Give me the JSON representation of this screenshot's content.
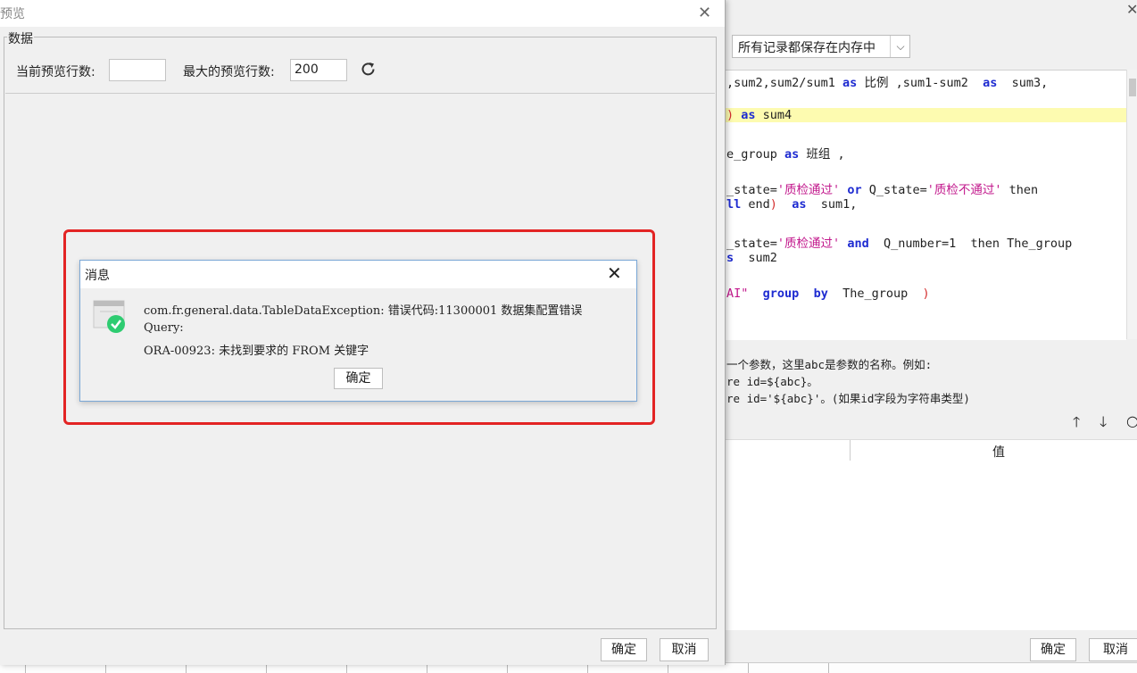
{
  "bg_window": {
    "storage_select_value": "所有记录都保存在内存中",
    "code_lines": [
      {
        "parts": [
          {
            "t": ",sum2,sum2/sum1 ",
            "c": ""
          },
          {
            "t": "as",
            "c": "kw"
          },
          {
            "t": " 比例 ,sum1-sum2  ",
            "c": ""
          },
          {
            "t": "as",
            "c": "kw"
          },
          {
            "t": "  sum3,",
            "c": ""
          }
        ]
      },
      {
        "parts": [
          {
            "t": ")",
            "c": "red"
          },
          {
            "t": " ",
            "c": ""
          },
          {
            "t": "as",
            "c": "kw"
          },
          {
            "t": " sum4",
            "c": ""
          }
        ],
        "highlight": true
      },
      {
        "parts": [
          {
            "t": "e_group ",
            "c": ""
          },
          {
            "t": "as",
            "c": "kw"
          },
          {
            "t": " 班组 ,",
            "c": ""
          }
        ]
      },
      {
        "parts": [
          {
            "t": "_state=",
            "c": ""
          },
          {
            "t": "'质检通过'",
            "c": "str"
          },
          {
            "t": " ",
            "c": ""
          },
          {
            "t": "or",
            "c": "kw"
          },
          {
            "t": " Q_state=",
            "c": ""
          },
          {
            "t": "'质检不通过'",
            "c": "str"
          },
          {
            "t": " then",
            "c": ""
          }
        ]
      },
      {
        "parts": [
          {
            "t": "ll",
            "c": "kw"
          },
          {
            "t": " end",
            "c": ""
          },
          {
            "t": ")",
            "c": "red"
          },
          {
            "t": "  ",
            "c": ""
          },
          {
            "t": "as",
            "c": "kw"
          },
          {
            "t": "  sum1,",
            "c": ""
          }
        ]
      },
      {
        "parts": [
          {
            "t": "_state=",
            "c": ""
          },
          {
            "t": "'质检通过'",
            "c": "str"
          },
          {
            "t": " ",
            "c": ""
          },
          {
            "t": "and",
            "c": "kw"
          },
          {
            "t": "  Q_number=1  then The_group",
            "c": ""
          }
        ]
      },
      {
        "parts": [
          {
            "t": "s",
            "c": "kw"
          },
          {
            "t": "  sum2",
            "c": ""
          }
        ]
      },
      {
        "parts": [
          {
            "t": "AI\"",
            "c": "str"
          },
          {
            "t": "  ",
            "c": ""
          },
          {
            "t": "group",
            "c": "kw"
          },
          {
            "t": "  ",
            "c": ""
          },
          {
            "t": "by",
            "c": "kw"
          },
          {
            "t": "  The_group  ",
            "c": ""
          },
          {
            "t": ")",
            "c": "red"
          }
        ]
      }
    ],
    "hint_lines": [
      "一个参数，这里abc是参数的名称。例如:",
      "re id=${abc}。",
      "re id='${abc}'。(如果id字段为字符串类型)"
    ],
    "param_value_header": "值",
    "ok_label": "确定",
    "cancel_label": "取消"
  },
  "preview": {
    "title": "预览",
    "group_label": "数据",
    "row_count_label": "当前预览行数:",
    "row_count_value": "",
    "max_rows_label": "最大的预览行数:",
    "max_rows_value": "200",
    "ok_label": "确定",
    "cancel_label": "取消"
  },
  "message_dialog": {
    "title": "消息",
    "lines": [
      "com.fr.general.data.TableDataException: 错误代码:11300001 数据集配置错误",
      "Query:",
      "ORA-00923: 未找到要求的 FROM 关键字"
    ],
    "ok_label": "确定"
  },
  "colors": {
    "highlight_border": "#e32424",
    "keyword": "#1e2bd1",
    "string": "#c2188c",
    "success_icon": "#2ecc71"
  }
}
